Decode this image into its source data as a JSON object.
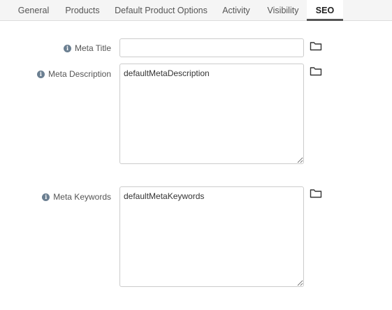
{
  "tabs": [
    {
      "label": "General"
    },
    {
      "label": "Products"
    },
    {
      "label": "Default Product Options"
    },
    {
      "label": "Activity"
    },
    {
      "label": "Visibility"
    },
    {
      "label": "SEO"
    }
  ],
  "active_tab": "SEO",
  "form": {
    "meta_title": {
      "label": "Meta Title",
      "value": ""
    },
    "meta_description": {
      "label": "Meta Description",
      "value": "defaultMetaDescription"
    },
    "meta_keywords": {
      "label": "Meta Keywords",
      "value": "defaultMetaKeywords"
    }
  },
  "icons": {
    "info": "info-icon",
    "browse": "folder-icon"
  },
  "colors": {
    "tab_bar_bg": "#f5f5f5",
    "active_tab_underline": "#555555",
    "info_icon": "#6b7f91"
  }
}
